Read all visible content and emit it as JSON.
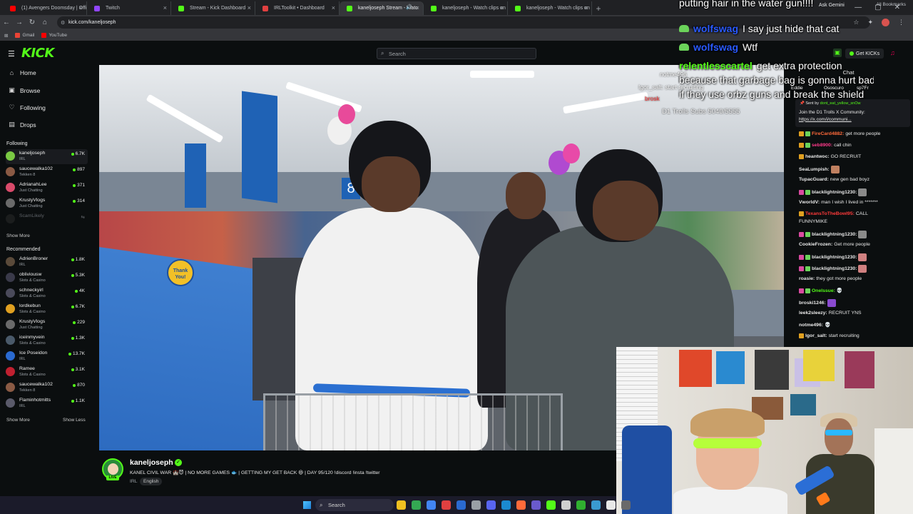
{
  "browser": {
    "tabs": [
      {
        "label": "(1) Avengers Doomsday | Offic",
        "color": "#ff0000",
        "active": false
      },
      {
        "label": "Twitch",
        "color": "#9146ff",
        "active": false
      },
      {
        "label": "Stream - Kick Dashboard",
        "color": "#53fc18",
        "active": false
      },
      {
        "label": "IRLToolkit • Dashboard",
        "color": "#e04040",
        "active": false
      },
      {
        "label": "kaneljoseph Stream - Watc",
        "color": "#53fc18",
        "active": true
      },
      {
        "label": "kaneljoseph - Watch clips on K",
        "color": "#53fc18",
        "active": false
      },
      {
        "label": "kaneljoseph - Watch clips on K",
        "color": "#53fc18",
        "active": false
      }
    ],
    "new_tab": "+",
    "ask_gemini": "Ask Gemini",
    "url": "kick.com/kaneljoseph",
    "bookmarks": [
      {
        "label": "Gmail",
        "color": "#ea4335"
      },
      {
        "label": "YouTube",
        "color": "#ff0000"
      }
    ],
    "all_bookmarks": "All Bookmarks"
  },
  "header": {
    "logo": "KICK",
    "search_placeholder": "Search",
    "get_kicks": "Get KICKs"
  },
  "sidebar": {
    "nav": [
      {
        "label": "Home",
        "icon": "home-icon",
        "glyph": "⌂"
      },
      {
        "label": "Browse",
        "icon": "browse-icon",
        "glyph": "▣"
      },
      {
        "label": "Following",
        "icon": "heart-icon",
        "glyph": "♡"
      },
      {
        "label": "Drops",
        "icon": "drops-icon",
        "glyph": "▤"
      }
    ],
    "following_title": "Following",
    "following": [
      {
        "name": "kaneljoseph",
        "category": "IRL",
        "viewers": "6.7K",
        "color": "#7ac943"
      },
      {
        "name": "saucewalka102",
        "category": "Tekken 8",
        "viewers": "897",
        "color": "#8a5a44"
      },
      {
        "name": "AdrianahLee",
        "category": "Just Chatting",
        "viewers": "371",
        "color": "#d94a6a"
      },
      {
        "name": "KrustyVlogs",
        "category": "Just Chatting",
        "viewers": "314",
        "color": "#6a6a6a"
      },
      {
        "name": "ScamLikely",
        "category": "",
        "viewers": "",
        "color": "#3a3a3a"
      }
    ],
    "show_more": "Show More",
    "recommended_title": "Recommended",
    "recommended": [
      {
        "name": "AdrienBroner",
        "category": "IRL",
        "viewers": "1.8K",
        "color": "#5a4a3a"
      },
      {
        "name": "obliviousw",
        "category": "Slots & Casino",
        "viewers": "5.3K",
        "color": "#3a3a4a"
      },
      {
        "name": "schneckyirl",
        "category": "Slots & Casino",
        "viewers": "4K",
        "color": "#4a4a5a"
      },
      {
        "name": "lordkebun",
        "category": "Slots & Casino",
        "viewers": "6.7K",
        "color": "#e0a020"
      },
      {
        "name": "KrustyVlogs",
        "category": "Just Chatting",
        "viewers": "229",
        "color": "#6a6a6a"
      },
      {
        "name": "iceinmyvein",
        "category": "Slots & Casino",
        "viewers": "1.3K",
        "color": "#4a5a6a"
      },
      {
        "name": "Ice Poseidon",
        "category": "IRL",
        "viewers": "13.7K",
        "color": "#2a6ad0"
      },
      {
        "name": "Ramee",
        "category": "Slots & Casino",
        "viewers": "3.1K",
        "color": "#c02030"
      },
      {
        "name": "saucewalka102",
        "category": "Tekken 8",
        "viewers": "870",
        "color": "#8a5a44"
      },
      {
        "name": "Flaminhotmitts",
        "category": "IRL",
        "viewers": "1.1K",
        "color": "#5a5a6a"
      }
    ],
    "show_more_2": "Show More",
    "show_less": "Show Less"
  },
  "video_overlay": {
    "usernames": [
      {
        "text": "notme496",
        "color": "#ffffff"
      },
      {
        "text": "Igor_salt: start recruiting",
        "color": "#ffffff"
      },
      {
        "text": "brosk",
        "color": "#ff3a3a"
      }
    ],
    "sub_goal": "D1 Trolls Subs 5040/5555",
    "thank_you_sign": "Thank You!",
    "aisle_number": "8"
  },
  "overlay_chat": [
    {
      "user": "",
      "message": "putting hair in the water gun!!!!",
      "user_color": "#ffffff"
    },
    {
      "user": "wolfswag",
      "message": "I say just hide that cat",
      "user_color": "#2a5aff"
    },
    {
      "user": "wolfswag",
      "message": "Wtf",
      "user_color": "#2a5aff"
    },
    {
      "user": "relentlesscartel",
      "message": "get extra protection",
      "user_color": "#53fc18"
    },
    {
      "user": "",
      "message": "because that garbage bag is gonna hurt bad",
      "user_color": "#ffffff"
    },
    {
      "user": "",
      "message": "if they use orbz guns and break the shield",
      "user_color": "#ffffff"
    }
  ],
  "chat": {
    "title": "Chat",
    "top_users": [
      "Eddie",
      "Ososcuro",
      "sp7Fr"
    ],
    "pinned": {
      "sent_by_label": "Sent by",
      "sent_by": "dont_eat_yellow_snOw",
      "body": "Join the D1 Trolls X Community:",
      "link": "https://x.com/i/communi..."
    },
    "messages": [
      {
        "user": "FireCard4882:",
        "text": "get more people",
        "user_color": "#ff6a3a",
        "badges": [
          "#e0a020",
          "#6bd35a"
        ]
      },
      {
        "user": "seb8900:",
        "text": "call chin",
        "user_color": "#ff3a8a",
        "badges": [
          "#e0a020",
          "#6bd35a"
        ]
      },
      {
        "user": "heantwoc:",
        "text": "GO RECRUIT",
        "user_color": "#e8e8e8",
        "badges": [
          "#e0a020"
        ]
      },
      {
        "user": "SeaLumpish:",
        "text": "",
        "user_color": "#e8e8e8",
        "badges": [],
        "emote": "#c08060"
      },
      {
        "user": "TupacGuard:",
        "text": "new gen bad boyz",
        "user_color": "#e8e8e8",
        "badges": []
      },
      {
        "user": "blacklightning1230:",
        "text": "",
        "user_color": "#e8e8e8",
        "badges": [
          "#d94aa0",
          "#6bd35a"
        ],
        "emote": "#8a8a8a"
      },
      {
        "user": "VworldV:",
        "text": "man I wish I lived in *******",
        "user_color": "#e8e8e8",
        "badges": []
      },
      {
        "user": "TexansToTheBowl95:",
        "text": "CALL",
        "user_color": "#ff3a3a",
        "badges": [
          "#e0a020"
        ]
      },
      {
        "user": "",
        "text": "FUNNYMIKE",
        "user_color": "#e8e8e8",
        "badges": []
      },
      {
        "user": "blacklightning1230:",
        "text": "",
        "user_color": "#e8e8e8",
        "badges": [
          "#d94aa0",
          "#6bd35a"
        ],
        "emote": "#8a8a8a"
      },
      {
        "user": "CookieFrozen:",
        "text": "Get more people",
        "user_color": "#e8e8e8",
        "badges": []
      },
      {
        "user": "blacklightning1230:",
        "text": "",
        "user_color": "#e8e8e8",
        "badges": [
          "#d94aa0",
          "#6bd35a"
        ],
        "emote": "#d08080"
      },
      {
        "user": "blacklightning1230:",
        "text": "",
        "user_color": "#e8e8e8",
        "badges": [
          "#d94aa0",
          "#6bd35a"
        ],
        "emote": "#d08080"
      },
      {
        "user": "roasie:",
        "text": "they got more people",
        "user_color": "#e8e8e8",
        "badges": []
      },
      {
        "user": "Onelssue:",
        "text": "💀",
        "user_color": "#53fc18",
        "badges": [
          "#d94aa0",
          "#6bd35a"
        ]
      },
      {
        "user": "broski1246:",
        "text": "",
        "user_color": "#e8e8e8",
        "badges": [],
        "emote": "#8a4ad0"
      },
      {
        "user": "leek2sleezy:",
        "text": "RECRUIT YNS",
        "user_color": "#e8e8e8",
        "badges": []
      },
      {
        "user": "notme496:",
        "text": "💀",
        "user_color": "#e8e8e8",
        "badges": []
      },
      {
        "user": "Igor_salt:",
        "text": "start recruiting",
        "user_color": "#e8e8e8",
        "badges": [
          "#e0a020"
        ]
      }
    ]
  },
  "stream": {
    "channel": "kaneljoseph",
    "title": "KANEL CIVIL WAR 🏰😈 | NO MORE GAMES 🐟 | GETTING MY GET BACK 😆 | DAY 95/120 !discord !insta !twitter",
    "category": "IRL",
    "language": "English",
    "live_label": "LIVE"
  },
  "webcam": {},
  "taskbar": {
    "search": "Search",
    "app_colors": [
      "#f0c020",
      "#34a853",
      "#4285f4",
      "#e04040",
      "#2a6ad0",
      "#9aa0a6",
      "#5865f2",
      "#1b8ad0",
      "#ff6a3a",
      "#6a5acd",
      "#53fc18",
      "#d0d0d0",
      "#30b030",
      "#3a9ad0",
      "#e8e8e8",
      "#6a6a6a"
    ]
  }
}
